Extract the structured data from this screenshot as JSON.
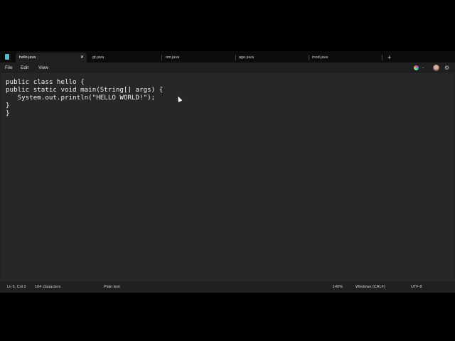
{
  "tabs": [
    {
      "label": "hello.java",
      "active": true
    },
    {
      "label": "gt.java"
    },
    {
      "label": "om.java"
    },
    {
      "label": "age.java"
    },
    {
      "label": "mod.java"
    }
  ],
  "tab_close": "✕",
  "new_tab": "+",
  "menu": {
    "file": "File",
    "edit": "Edit",
    "view": "View"
  },
  "icons": {
    "settings": "⚙",
    "chevron": "⌄"
  },
  "editor": {
    "content": "public class hello {\npublic static void main(String[] args) {\n   System.out.println(\"HELLO WORLD!\");\n}\n}"
  },
  "status": {
    "position": "Ln 5, Col 2",
    "chars": "104 characters",
    "format": "Plain text",
    "zoom": "140%",
    "line_ending": "Windows (CRLF)",
    "encoding": "UTF-8"
  }
}
